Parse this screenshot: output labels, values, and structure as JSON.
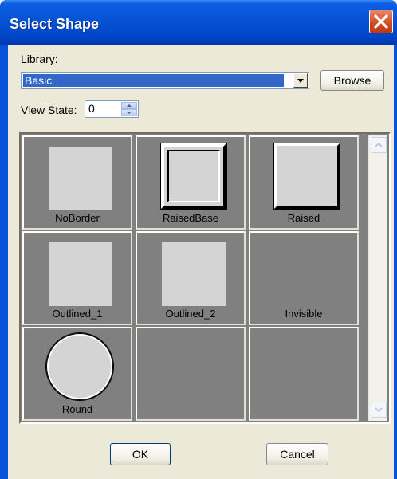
{
  "window": {
    "title": "Select Shape",
    "close_icon": "close-icon"
  },
  "library": {
    "label": "Library:",
    "value": "Basic",
    "browse_label": "Browse"
  },
  "view_state": {
    "label": "View State:",
    "value": "0"
  },
  "shapes": [
    {
      "label": "NoBorder",
      "style": "flat"
    },
    {
      "label": "RaisedBase",
      "style": "raised-base"
    },
    {
      "label": "Raised",
      "style": "raised"
    },
    {
      "label": "Outlined_1",
      "style": "flat"
    },
    {
      "label": "Outlined_2",
      "style": "flat"
    },
    {
      "label": "Invisible",
      "style": "none"
    },
    {
      "label": "Round",
      "style": "round"
    },
    {
      "label": "",
      "style": "none"
    },
    {
      "label": "",
      "style": "none"
    }
  ],
  "buttons": {
    "ok": "OK",
    "cancel": "Cancel"
  },
  "colors": {
    "titlebar": "#0054e3",
    "dialog_bg": "#ece9d8",
    "selection": "#3168c7",
    "grid_bg": "#808080",
    "shape_fill": "#d4d4d4"
  }
}
